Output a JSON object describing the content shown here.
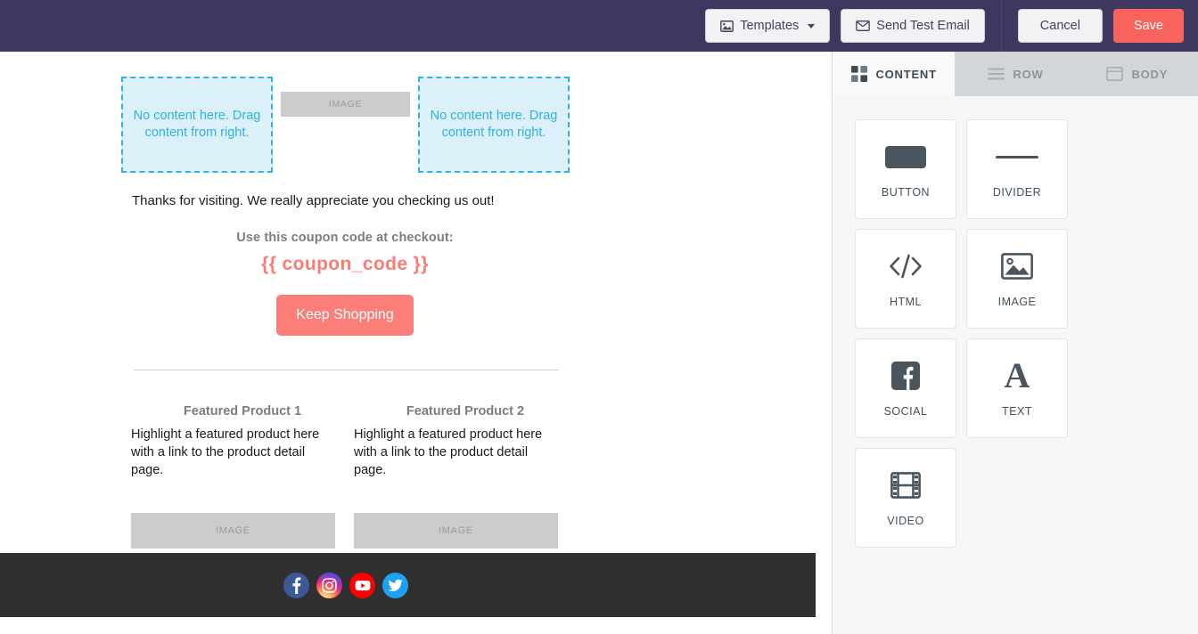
{
  "topbar": {
    "templates_label": "Templates",
    "templates_icon": "image-icon",
    "dropdown_icon": "chevron-down-icon",
    "send_test_label": "Send Test Email",
    "send_test_icon": "envelope-icon",
    "cancel_label": "Cancel",
    "save_label": "Save",
    "save_color": "#f9635e",
    "background_color": "#3e3860"
  },
  "canvas": {
    "dropzone_text": "No content here. Drag content from right.",
    "dropzone_color": "#2cb2e4",
    "image_placeholder_label": "IMAGE",
    "thanks_text": "Thanks for visiting. We really appreciate you checking us out!",
    "coupon_label": "Use this coupon code at checkout:",
    "coupon_code": "{{ coupon_code }}",
    "coupon_color": "#fb7b72",
    "shop_button_label": "Keep Shopping",
    "shop_button_color": "#fb7f78",
    "products": [
      {
        "title": "Featured Product 1",
        "description": "Highlight a featured product here with a link to the product detail page.",
        "image_label": "IMAGE"
      },
      {
        "title": "Featured Product 2",
        "description": "Highlight a featured product here with a link to the product detail page.",
        "image_label": "IMAGE"
      }
    ],
    "footer": {
      "background_color": "#303030",
      "social": [
        {
          "name": "facebook",
          "icon": "facebook-icon",
          "color": "#3b5998"
        },
        {
          "name": "instagram",
          "icon": "instagram-icon",
          "color": "#d6249f"
        },
        {
          "name": "youtube",
          "icon": "youtube-icon",
          "color": "#ff0000"
        },
        {
          "name": "twitter",
          "icon": "twitter-icon",
          "color": "#1da1f2"
        }
      ]
    }
  },
  "panel": {
    "tabs": [
      {
        "label": "CONTENT",
        "icon": "grid-icon",
        "active": true
      },
      {
        "label": "ROW",
        "icon": "rows-icon",
        "active": false
      },
      {
        "label": "BODY",
        "icon": "window-icon",
        "active": false
      }
    ],
    "blocks": [
      {
        "label": "BUTTON",
        "icon": "button-icon"
      },
      {
        "label": "DIVIDER",
        "icon": "divider-icon"
      },
      {
        "label": "HTML",
        "icon": "code-icon"
      },
      {
        "label": "IMAGE",
        "icon": "image-icon"
      },
      {
        "label": "SOCIAL",
        "icon": "facebook-square-icon"
      },
      {
        "label": "TEXT",
        "icon": "letter-a-icon"
      },
      {
        "label": "VIDEO",
        "icon": "film-icon"
      }
    ]
  }
}
